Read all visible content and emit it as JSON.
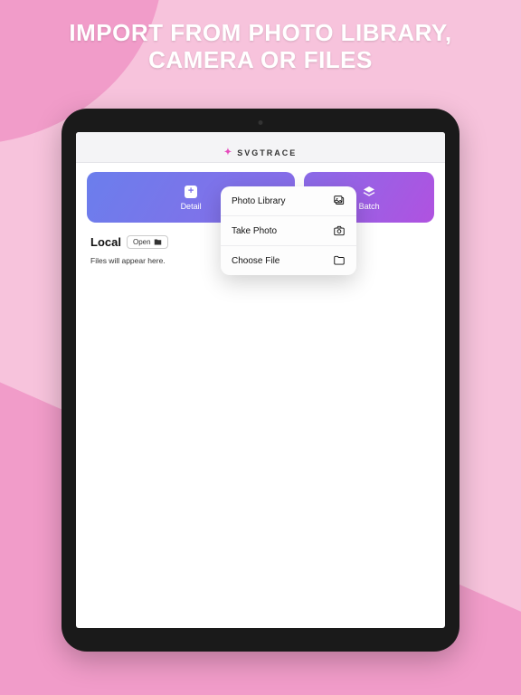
{
  "marketing": {
    "headline_line1": "IMPORT FROM PHOTO LIBRARY,",
    "headline_line2": "CAMERA OR FILES"
  },
  "app": {
    "name": "SVGTRACE"
  },
  "cards": {
    "details": {
      "label": "Detail"
    },
    "batch": {
      "label": "Batch"
    }
  },
  "local": {
    "title": "Local",
    "open_label": "Open",
    "empty_text": "Files will appear here."
  },
  "popover": {
    "items": [
      {
        "label": "Photo Library",
        "icon": "photo-library-icon"
      },
      {
        "label": "Take Photo",
        "icon": "camera-icon"
      },
      {
        "label": "Choose File",
        "icon": "folder-icon"
      }
    ]
  },
  "colors": {
    "bg_light": "#f7c3dc",
    "bg_dark": "#f19cc9",
    "grad_a": "#6b7eec",
    "grad_b": "#8a6be8",
    "grad_c": "#b052e0",
    "accent": "#e64bbd"
  }
}
